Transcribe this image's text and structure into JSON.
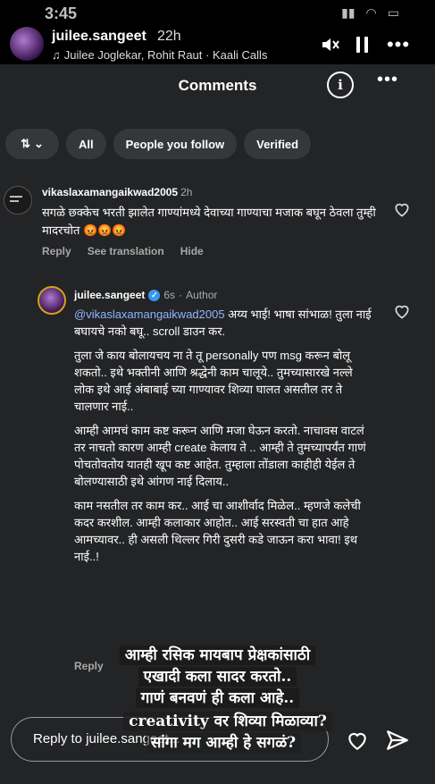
{
  "status": {
    "time": "3:45"
  },
  "story": {
    "username": "juilee.sangeet",
    "time_ago": "22h",
    "music": "Juilee Joglekar, Rohit Raut · Kaali Calls"
  },
  "sheet": {
    "title": "Comments",
    "filters": [
      "All",
      "People you follow",
      "Verified"
    ]
  },
  "comment1": {
    "username": "vikaslaxamangaikwad2005",
    "time": "2h",
    "text": "सगळे छक्केच भरती झालेत गाण्यांमध्ये देवाच्या गाण्याचा मजाक बघून ठेवला तुम्ही मादरचोत 😡😡😡",
    "actions": [
      "Reply",
      "See translation",
      "Hide"
    ]
  },
  "comment2": {
    "username": "juilee.sangeet",
    "time": "6s",
    "role": "Author",
    "mention": "@vikaslaxamangaikwad2005",
    "p1_rest": " अय्य भाई! भाषा सांभाळ! तुला नाई बघायचे नको बघू.. scroll डाउन कर.",
    "p2": "तुला जे काय बोलायचय ना ते तू personally पण msg करून बोलू शकतो.. इथे भक्तीनी आणि श्रद्धेनी काम चालूये.. तुमच्यासारखे नल्ले लोक इथे आई अंबाबाई च्या गाण्यावर शिव्या घालत असतील तर ते चालणार नाई..",
    "p3": "आम्ही आमचं काम कष्ट करून आणि मजा घेऊन करतो. नाचावस वाटलं तर नाचतो कारण आम्ही create केलाय ते .. आम्ही ते तुमच्यापर्यंत गाणं पोचतोवतोय यातही खूप कष्ट आहेत. तुम्हाला तोंडाला काहीही येईल ते बोलण्यासाठी इथे आंगण नाई दिलाय..",
    "p4": "काम नसतील तर काम कर.. आई चा आशीर्वाद मिळेल.. म्हणजे कलेची कदर करशील. आम्ही कलाकार आहोत.. आई सरस्वती चा हात आहे आमच्यावर.. ही असली थिल्लर गिरी दुसरी कडे जाऊन करा भावा! इथ नाई..!",
    "reply": "Reply"
  },
  "overlay": {
    "line1": "आम्ही रसिक मायबाप प्रेक्षकांसाठी",
    "line2": "एखादी कला सादर करतो..",
    "line3": "गाणं बनवणं ही कला आहे..",
    "line4": "creativity वर शिव्या मिळाव्या?",
    "line5": "सांगा मग आम्ही हे सगळं?"
  },
  "reply_box": {
    "placeholder": "Reply to juilee.sangeet..."
  }
}
